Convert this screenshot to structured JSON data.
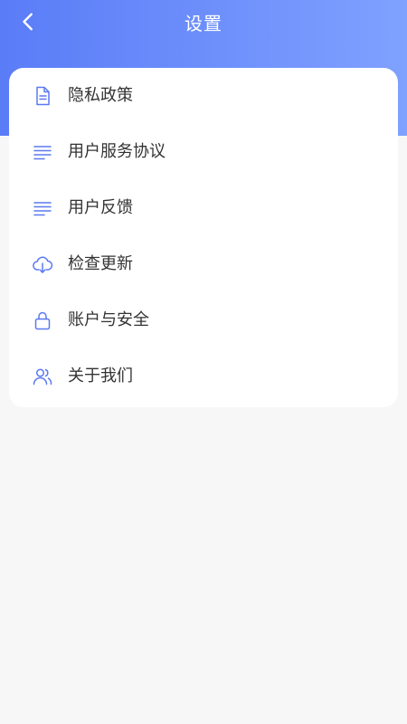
{
  "header": {
    "title": "设置",
    "accent_start": "#5a7cf7",
    "accent_end": "#7fa1ff"
  },
  "menu": {
    "items": [
      {
        "icon": "document-icon",
        "label": "隐私政策"
      },
      {
        "icon": "text-lines-icon",
        "label": "用户服务协议"
      },
      {
        "icon": "text-lines-icon",
        "label": "用户反馈"
      },
      {
        "icon": "cloud-download-icon",
        "label": "检查更新"
      },
      {
        "icon": "lock-icon",
        "label": "账户与安全"
      },
      {
        "icon": "users-icon",
        "label": "关于我们"
      }
    ],
    "icon_color": "#5b79f0"
  }
}
